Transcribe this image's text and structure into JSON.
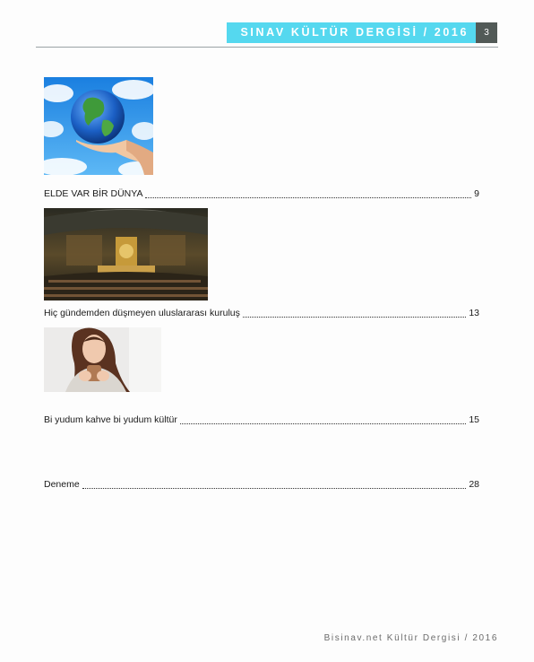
{
  "header": {
    "title": "SINAV KÜLTÜR DERGİSİ / 2016",
    "page_number": "3",
    "banner_color": "#55d8ef",
    "page_box_color": "#525a57"
  },
  "toc": [
    {
      "title": "ELDE VAR BİR DÜNYA",
      "page": "9",
      "image": "earth-in-hand-image"
    },
    {
      "title": "Hiç gündemden düşmeyen uluslararası kuruluş",
      "page": "13",
      "image": "un-assembly-hall-image"
    },
    {
      "title": "Bi yudum kahve bi yudum kültür",
      "page": "15",
      "image": "woman-with-coffee-image"
    },
    {
      "title": "Deneme",
      "page": "28"
    }
  ],
  "footer": {
    "text": "Bisinav.net Kültür Dergisi / 2016"
  }
}
